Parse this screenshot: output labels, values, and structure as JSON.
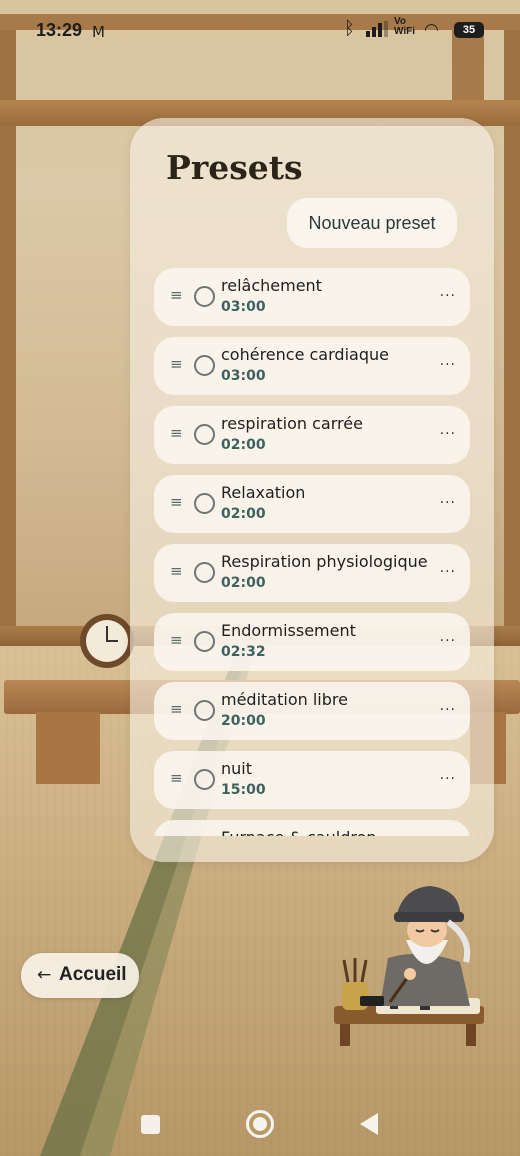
{
  "status_bar": {
    "time": "13:29",
    "network_label": "Vo\nWiFi",
    "battery": "35",
    "icons": [
      "gmail-icon",
      "bluetooth-icon",
      "signal-icon",
      "vowifi-icon",
      "wifi-icon",
      "battery-icon"
    ]
  },
  "presets_panel": {
    "title": "Presets",
    "new_button": "Nouveau preset",
    "items": [
      {
        "name": "relâchement",
        "duration": "03:00"
      },
      {
        "name": "cohérence cardiaque",
        "duration": "03:00"
      },
      {
        "name": "respiration carrée",
        "duration": "02:00"
      },
      {
        "name": "Relaxation",
        "duration": "02:00"
      },
      {
        "name": "Respiration physiologique",
        "duration": "02:00"
      },
      {
        "name": "Endormissement",
        "duration": "02:32"
      },
      {
        "name": "méditation libre",
        "duration": "20:00"
      },
      {
        "name": "nuit",
        "duration": "15:00"
      },
      {
        "name": "Furnace & cauldron",
        "duration": ""
      }
    ],
    "drag_handle_glyph": "≡",
    "more_glyph": "···"
  },
  "home_button": {
    "arrow": "←",
    "label": "Accueil"
  },
  "colors": {
    "panel_bg": "#f7f0e4",
    "accent_duration": "#3d6260",
    "title": "#2b2418"
  }
}
